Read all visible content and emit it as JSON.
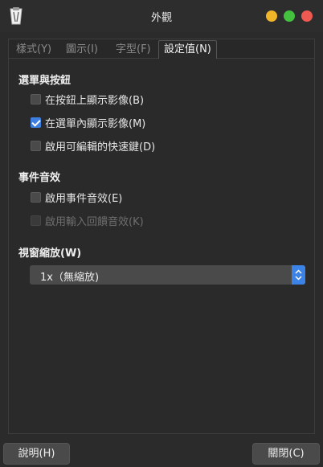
{
  "window": {
    "title": "外觀",
    "icon": "clipboard-icon",
    "controls": [
      "minimize",
      "maximize",
      "close"
    ],
    "control_colors": {
      "minimize": "#f0b429",
      "maximize": "#44c23f",
      "close": "#ee5a52"
    }
  },
  "tabs": [
    {
      "label": "樣式(Y)",
      "active": false
    },
    {
      "label": "圖示(I)",
      "active": false
    },
    {
      "label": "字型(F)",
      "active": false
    },
    {
      "label": "設定值(N)",
      "active": true
    }
  ],
  "menus_buttons": {
    "heading": "選單與按鈕",
    "options": [
      {
        "label": "在按鈕上顯示影像(B)",
        "checked": false,
        "enabled": true
      },
      {
        "label": "在選單內顯示影像(M)",
        "checked": true,
        "enabled": true
      },
      {
        "label": "啟用可編輯的快速鍵(D)",
        "checked": false,
        "enabled": true
      }
    ]
  },
  "event_sounds": {
    "heading": "事件音效",
    "options": [
      {
        "label": "啟用事件音效(E)",
        "checked": false,
        "enabled": true
      },
      {
        "label": "啟用輸入回饋音效(K)",
        "checked": false,
        "enabled": false
      }
    ]
  },
  "window_scaling": {
    "heading": "視窗縮放(W)",
    "selected": "1x（無縮放)"
  },
  "footer": {
    "help_label": "說明(H)",
    "close_label": "關閉(C)"
  },
  "colors": {
    "accent": "#3d7fe0",
    "background": "#2b2b2b"
  }
}
